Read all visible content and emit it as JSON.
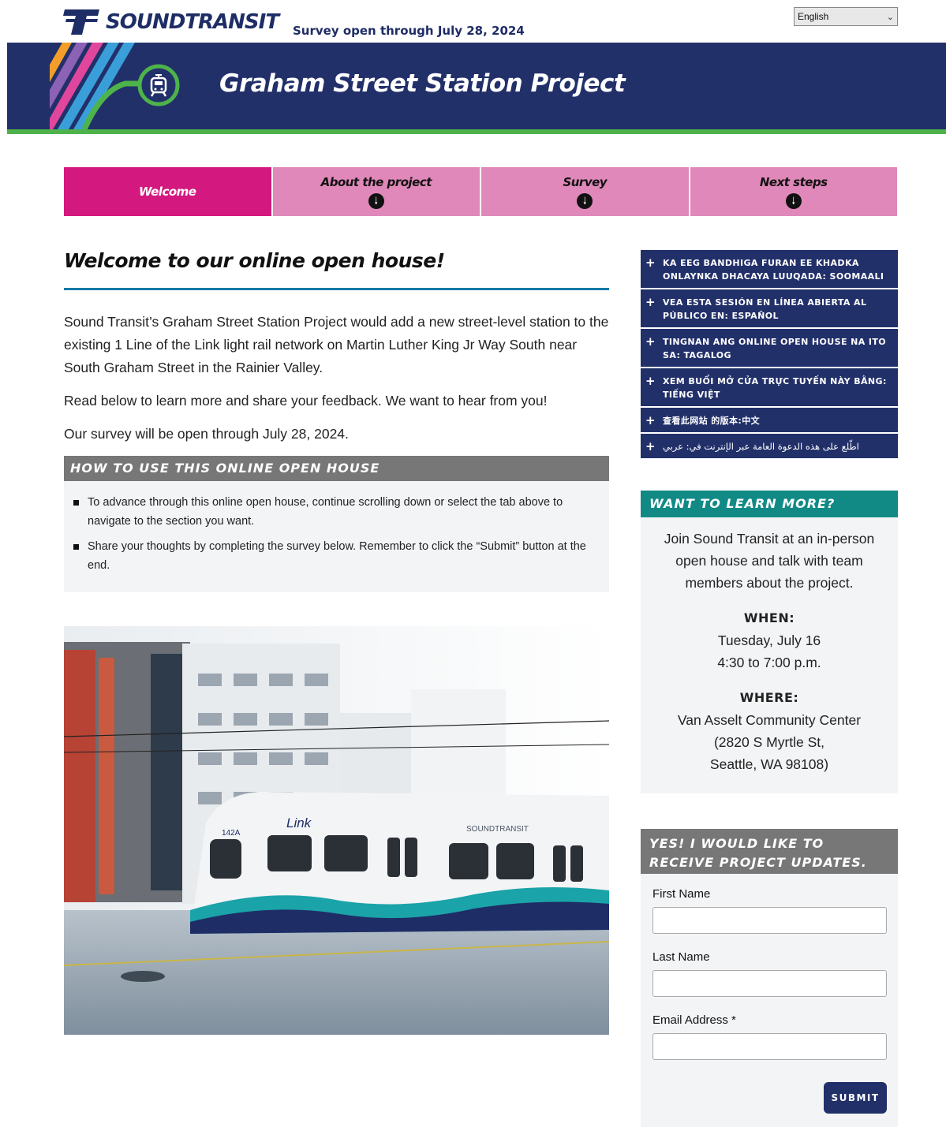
{
  "header": {
    "logo_text": "SOUNDTRANSIT",
    "survey_notice": "Survey open through July 28, 2024",
    "language_select": "English"
  },
  "banner": {
    "title": "Graham Street Station Project"
  },
  "tabs": [
    {
      "label": "Welcome",
      "active": true
    },
    {
      "label": "About the project",
      "active": false
    },
    {
      "label": "Survey",
      "active": false
    },
    {
      "label": "Next steps",
      "active": false
    }
  ],
  "main": {
    "heading": "Welcome to our online open house!",
    "paragraphs": [
      "Sound Transit’s Graham Street Station Project would add a new street-level station to the existing 1 Line of the Link light rail network on Martin Luther King Jr Way South near South Graham Street in the Rainier Valley.",
      "Read below to learn more and share your feedback. We want to hear from you!",
      "Our survey will be open through July 28, 2024."
    ],
    "howto": {
      "heading": "HOW TO USE THIS ONLINE OPEN HOUSE",
      "items": [
        "To advance through this online open house, continue scrolling down or select the tab above to navigate to the section you want.",
        "Share your thoughts by completing the survey below. Remember to click the “Submit” button at the end."
      ]
    },
    "photo": {
      "train_brand": "Link",
      "car_number": "142A",
      "car_logo": "SOUNDTRANSIT"
    }
  },
  "sidebar": {
    "languages": [
      {
        "text": "KA EEG BANDHIGA FURAN EE KHADKA ONLAYNKA DHACAYA LUUQADA: SOOMAALI"
      },
      {
        "text": "VEA ESTA SESIÓN EN LÍNEA ABIERTA AL PÚBLICO EN: ESPAÑOL"
      },
      {
        "text": "TINGNAN ANG ONLINE OPEN HOUSE NA ITO SA: TAGALOG"
      },
      {
        "text": "XEM BUỔI MỞ CỬA TRỰC TUYẾN NÀY BẰNG: TIẾNG VIỆT"
      },
      {
        "text": "查看此网站 的版本:中文"
      },
      {
        "text": "اطّلع على هذه الدعوة العامة عبر الإنترنت في: عربي"
      }
    ],
    "learn_more": {
      "heading": "WANT TO LEARN MORE?",
      "intro": "Join Sound Transit at an in-person open house and talk with team members about the project.",
      "when_label": "WHEN:",
      "when_date": "Tuesday, July 16",
      "when_time": "4:30 to 7:00 p.m.",
      "where_label": "WHERE:",
      "where_name": "Van Asselt Community Center",
      "where_street": "(2820 S Myrtle St,",
      "where_city": "Seattle, WA 98108)"
    },
    "updates": {
      "heading": "YES! I WOULD LIKE TO RECEIVE PROJECT UPDATES.",
      "first_name_label": "First Name",
      "last_name_label": "Last Name",
      "email_label": "Email Address *",
      "submit_label": "SUBMIT"
    }
  }
}
